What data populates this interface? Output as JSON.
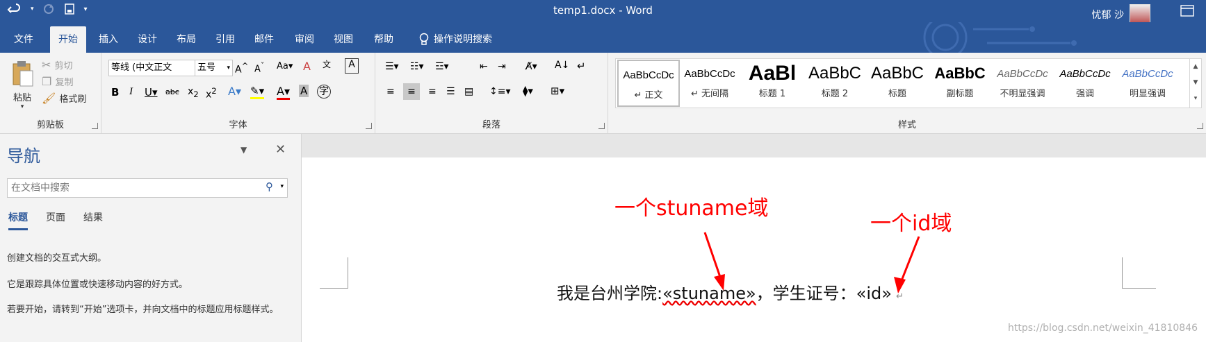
{
  "window": {
    "title": "temp1.docx - Word",
    "user": "忧郁 沙"
  },
  "tabs": [
    "文件",
    "开始",
    "插入",
    "设计",
    "布局",
    "引用",
    "邮件",
    "审阅",
    "视图",
    "帮助"
  ],
  "tell_me": "操作说明搜索",
  "clipboard": {
    "paste": "粘贴",
    "cut": "剪切",
    "copy": "复制",
    "format_painter": "格式刷",
    "label": "剪贴板"
  },
  "font": {
    "name": "等线 (中文正文",
    "size": "五号",
    "label": "字体"
  },
  "paragraph": {
    "label": "段落"
  },
  "styles": {
    "label": "样式",
    "items": [
      {
        "preview": "AaBbCcDc",
        "name": "↵ 正文"
      },
      {
        "preview": "AaBbCcDc",
        "name": "↵ 无间隔"
      },
      {
        "preview": "AaBl",
        "name": "标题 1"
      },
      {
        "preview": "AaBbC",
        "name": "标题 2"
      },
      {
        "preview": "AaBbC",
        "name": "标题"
      },
      {
        "preview": "AaBbC",
        "name": "副标题"
      },
      {
        "preview": "AaBbCcDc",
        "name": "不明显强调"
      },
      {
        "preview": "AaBbCcDc",
        "name": "强调"
      },
      {
        "preview": "AaBbCcDc",
        "name": "明显强调"
      }
    ]
  },
  "nav": {
    "title": "导航",
    "search_placeholder": "在文档中搜索",
    "tabs": [
      "标题",
      "页面",
      "结果"
    ],
    "desc1": "创建文档的交互式大纲。",
    "desc2": "它是跟踪具体位置或快速移动内容的好方式。",
    "desc3": "若要开始，请转到“开始”选项卡，并向文档中的标题应用标题样式。"
  },
  "doc": {
    "text_prefix": "我是台州学院:",
    "field_stuname": "«stuname»",
    "text_mid": "，学生证号：",
    "field_id": "«id»",
    "para_mark": "↵"
  },
  "annotations": {
    "stuname": "一个stuname域",
    "id": "一个id域",
    "color": "#ff0000"
  },
  "watermark": "https://blog.csdn.net/weixin_41810846"
}
